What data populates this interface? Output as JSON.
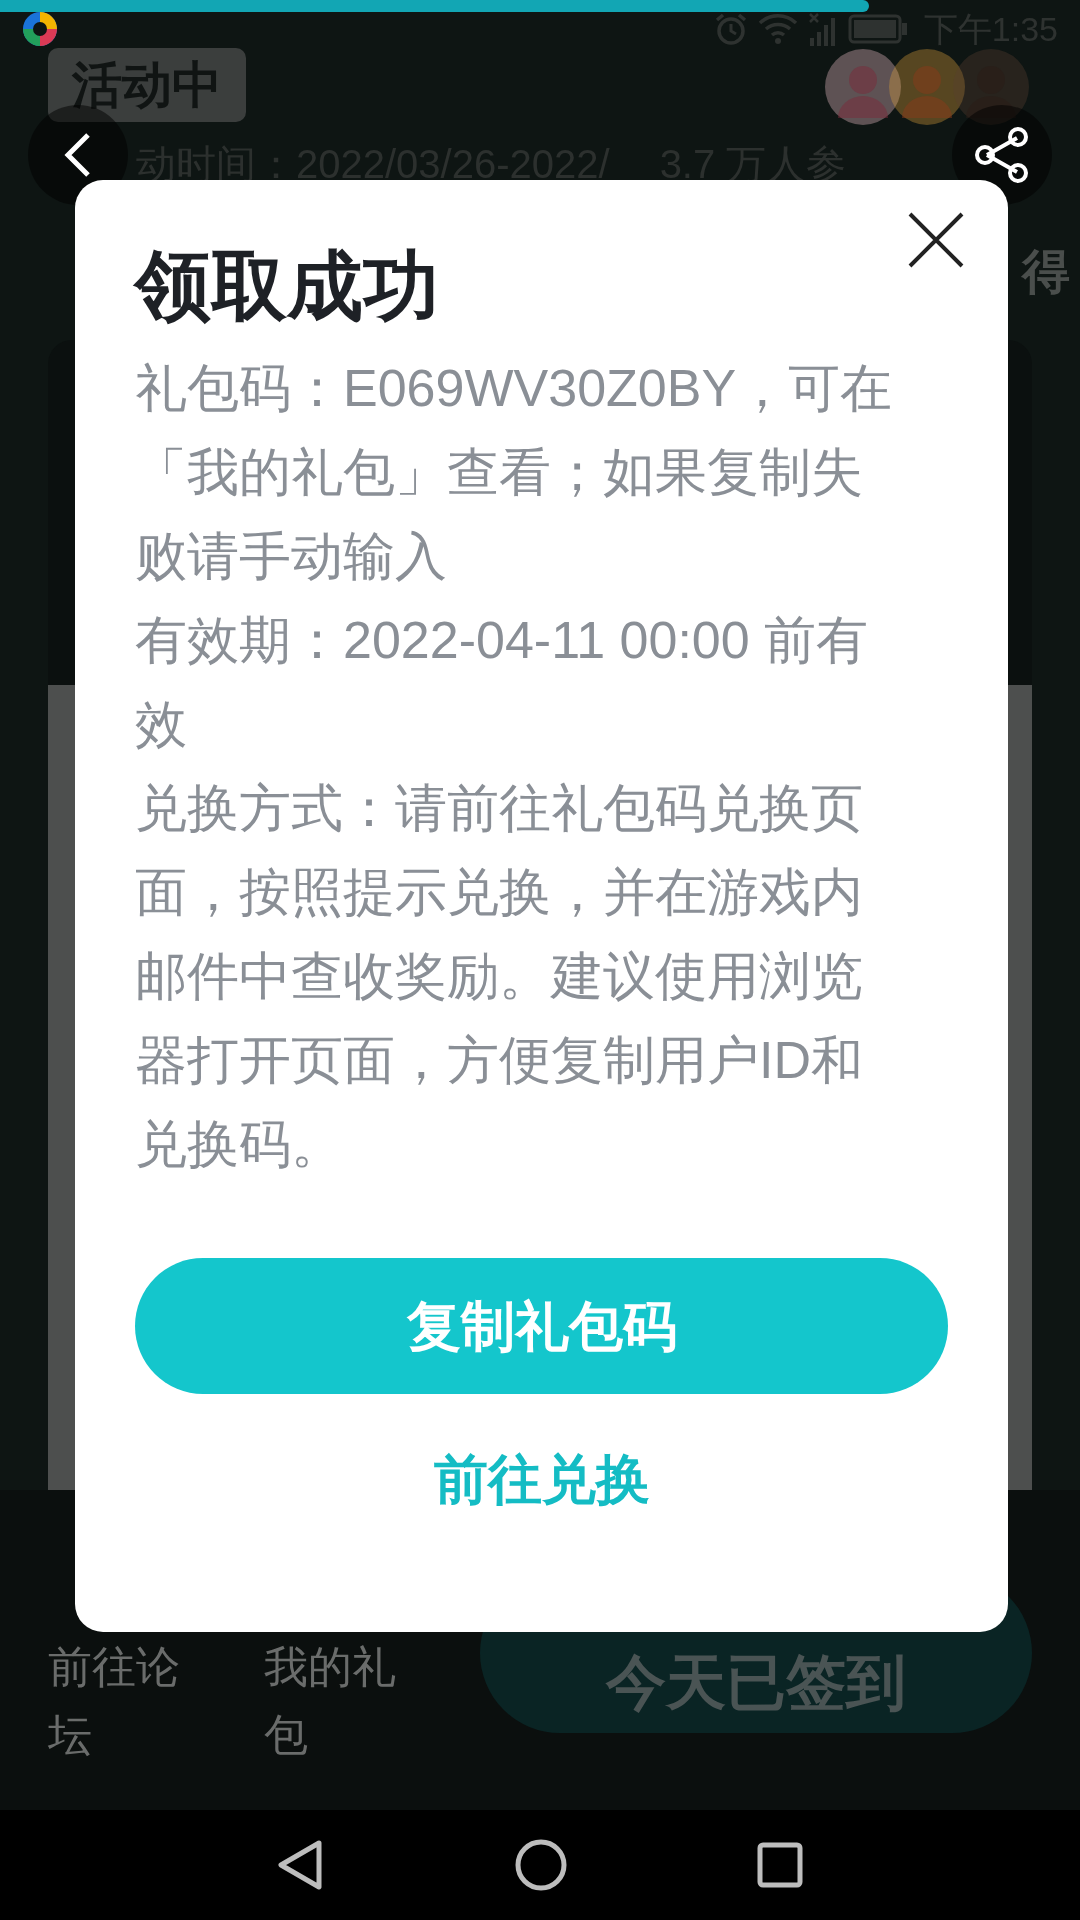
{
  "status_bar": {
    "time": "下午1:35"
  },
  "page": {
    "status_badge": "活动中",
    "activity_time": "动时间：2022/03/26-2022/",
    "participants": "3.7 万人参",
    "side_text": "得",
    "bottom_links": [
      "前往论坛",
      "我的礼包"
    ],
    "checkin_button": "今天已签到"
  },
  "dialog": {
    "title": "领取成功",
    "paragraphs": [
      "礼包码：E069WV30Z0BY，可在「我的礼包」查看；如果复制失败请手动输入",
      "有效期：2022-04-11 00:00 前有效",
      "兑换方式：请前往礼包码兑换页面，按照提示兑换，并在游戏内邮件中查收奖励。建议使用浏览器打开页面，方便复制用户ID和兑换码。"
    ],
    "primary_button": "复制礼包码",
    "secondary_link": "前往兑换"
  }
}
